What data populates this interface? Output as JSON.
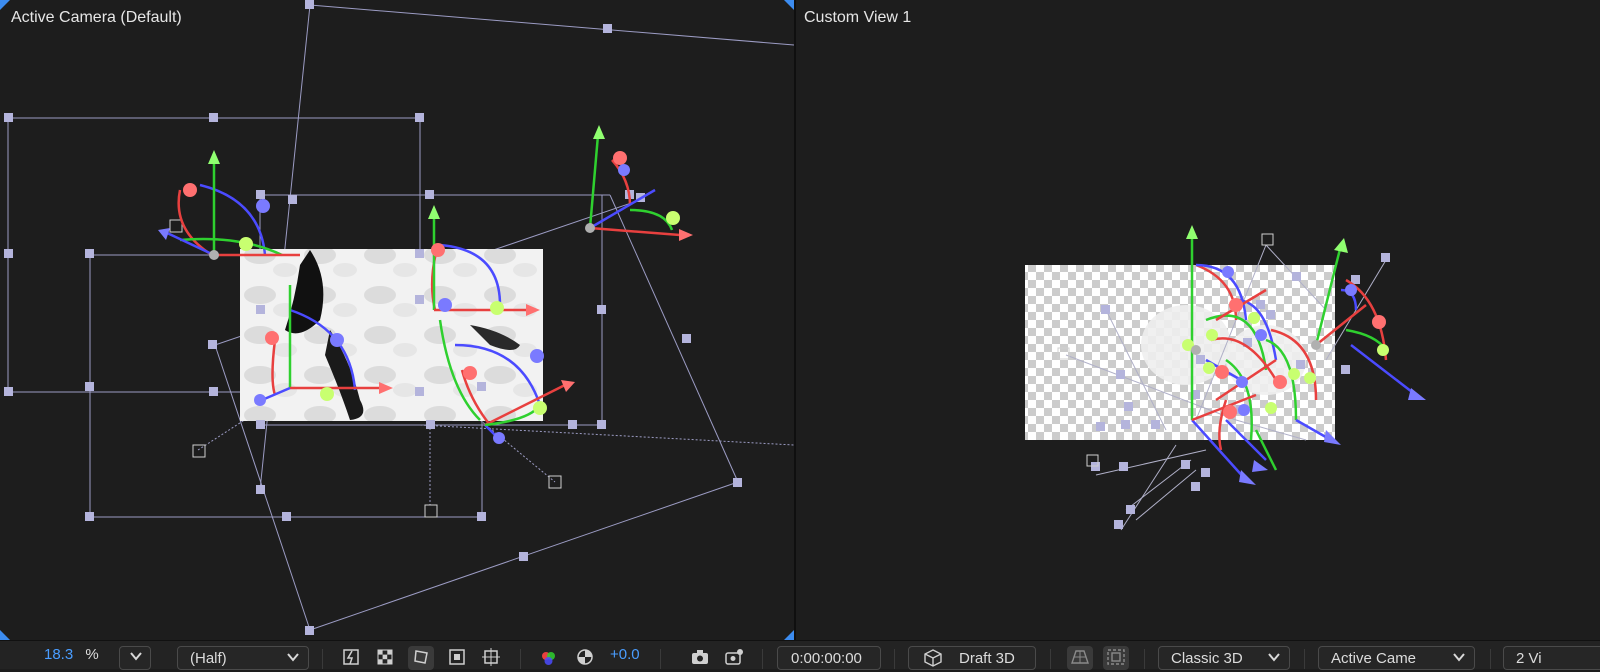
{
  "left_view": {
    "label": "Active Camera (Default)"
  },
  "right_view": {
    "label": "Custom View 1"
  },
  "bottom_bar": {
    "zoom_value": "18.3",
    "zoom_unit": "%",
    "zoom_dropdown_icon": "chevron-down-icon",
    "resolution": "(Half)",
    "fast_previews_icon": "lightning-icon",
    "transparency_grid_icon": "checkerboard-icon",
    "mask_path_icon": "mask-path-icon",
    "region_of_interest_icon": "region-of-interest-icon",
    "grid_guides_icon": "grid-guides-icon",
    "channels_icon": "rgb-channels-icon",
    "exposure_reset_icon": "exposure-reset-icon",
    "exposure_value": "+0.0",
    "snapshot_icon": "camera-icon",
    "show_snapshot_icon": "show-snapshot-icon",
    "timecode": "0:00:00:00",
    "draft_3d_icon": "cube-icon",
    "draft_3d_label": "Draft 3D",
    "ground_plane_icon": "ground-plane-icon",
    "extended_viewer_icon": "extended-viewer-icon",
    "renderer": "Classic 3D",
    "camera_view": "Active Came",
    "view_layout": "2 Vi"
  },
  "colors": {
    "background": "#1d1d1d",
    "axis_red": "#e8403f",
    "axis_green": "#2fd02f",
    "axis_blue": "#4b4bff",
    "handle": "#b4b4dc",
    "accent_blue": "#4a9dff"
  }
}
